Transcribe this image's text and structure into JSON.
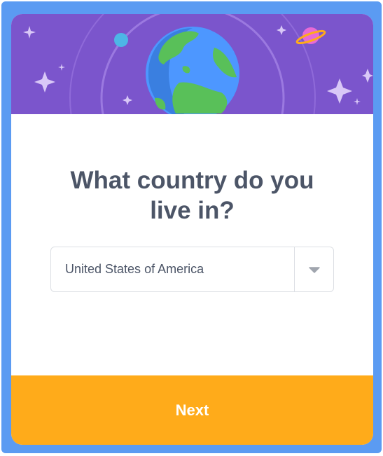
{
  "dialog": {
    "question_line1": "What country do you",
    "question_line2": "live in?",
    "country_select": {
      "selected_value": "United States of America",
      "icon": "caret-down-icon"
    },
    "next_label": "Next"
  },
  "banner": {
    "illustration": "earth-globe-illustration",
    "decorations": [
      "sparkle-icon",
      "planet-icon",
      "moon-icon",
      "orbit-ring"
    ]
  },
  "colors": {
    "frame": "#5b9bf2",
    "banner": "#7b55cc",
    "heading_text": "#4c5567",
    "next_button": "#ffab1a",
    "earth_water": "#4d97ff",
    "earth_land": "#59c059"
  }
}
